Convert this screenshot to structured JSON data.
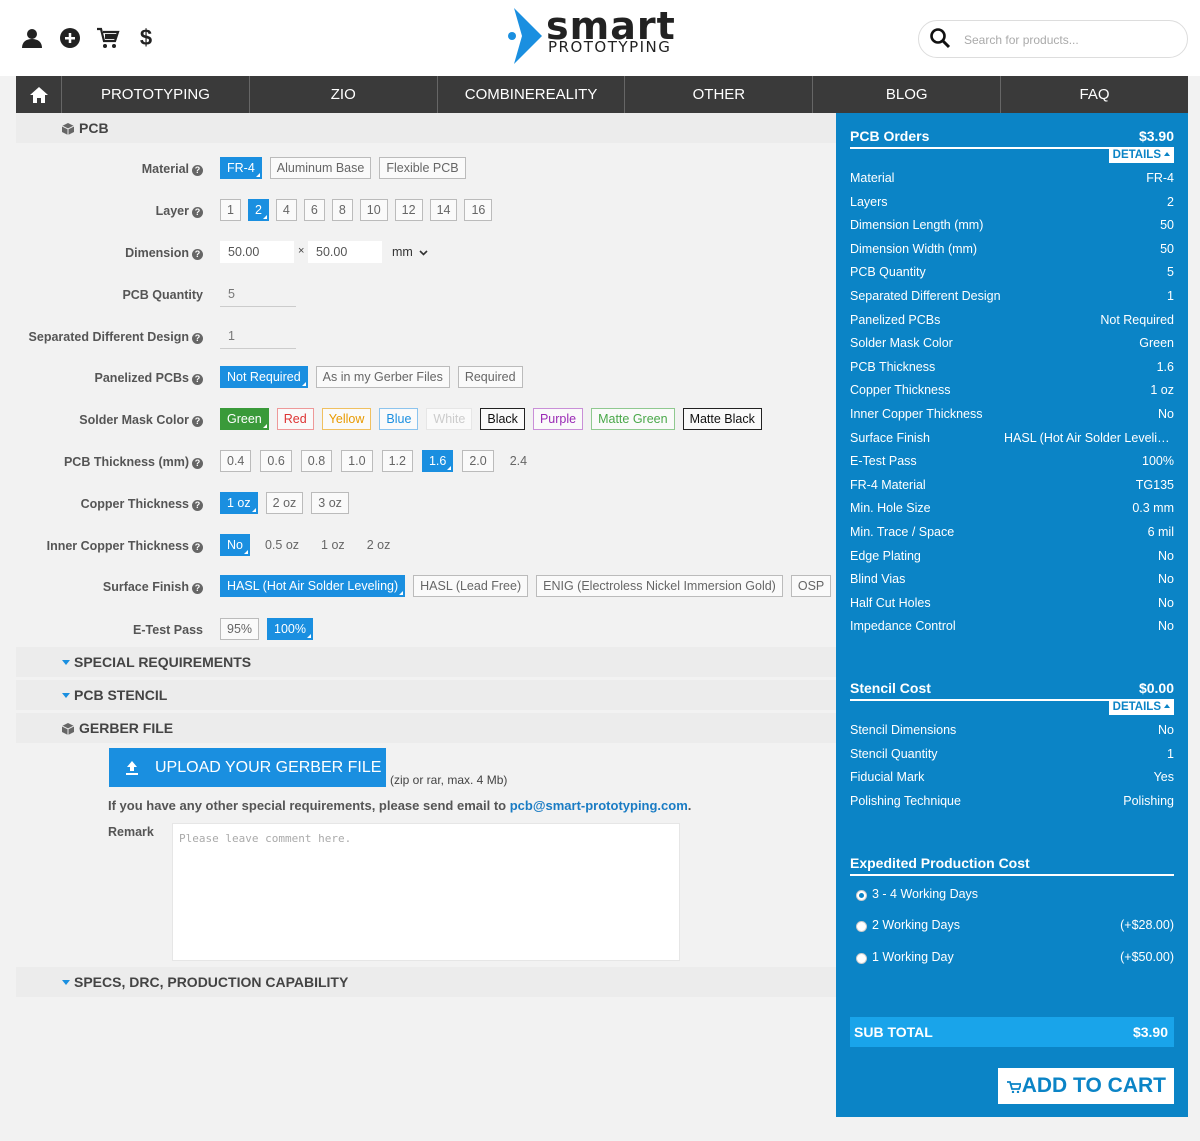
{
  "header": {
    "logo_word": "smart",
    "logo_sub": "PROTOTYPING",
    "search_placeholder": "Search for products..."
  },
  "nav": {
    "items": [
      "PROTOTYPING",
      "ZIO",
      "COMBINEREALITY",
      "OTHER",
      "BLOG",
      "FAQ"
    ]
  },
  "sections": {
    "pcb": "PCB",
    "special": "SPECIAL REQUIREMENTS",
    "stencil": "PCB STENCIL",
    "gerber": "GERBER FILE",
    "specs": "SPECS, DRC, PRODUCTION CAPABILITY"
  },
  "form": {
    "material": {
      "label": "Material",
      "options": [
        "FR-4",
        "Aluminum Base",
        "Flexible PCB"
      ],
      "selected": "FR-4"
    },
    "layer": {
      "label": "Layer",
      "options": [
        "1",
        "2",
        "4",
        "6",
        "8",
        "10",
        "12",
        "14",
        "16"
      ],
      "selected": "2"
    },
    "dimension": {
      "label": "Dimension",
      "length": "50.00",
      "width": "50.00",
      "times": "×",
      "unit": "mm"
    },
    "quantity": {
      "label": "PCB Quantity",
      "value": "5"
    },
    "separated": {
      "label": "Separated Different Design",
      "value": "1"
    },
    "panelized": {
      "label": "Panelized PCBs",
      "options": [
        "Not Required",
        "As in my Gerber Files",
        "Required"
      ],
      "selected": "Not Required"
    },
    "solder_mask": {
      "label": "Solder Mask Color",
      "options": [
        "Green",
        "Red",
        "Yellow",
        "Blue",
        "White",
        "Black",
        "Purple",
        "Matte Green",
        "Matte Black"
      ],
      "selected": "Green"
    },
    "thickness": {
      "label": "PCB Thickness (mm)",
      "options": [
        "0.4",
        "0.6",
        "0.8",
        "1.0",
        "1.2",
        "1.6",
        "2.0",
        "2.4"
      ],
      "selected": "1.6"
    },
    "copper": {
      "label": "Copper Thickness",
      "options": [
        "1 oz",
        "2 oz",
        "3 oz"
      ],
      "selected": "1 oz"
    },
    "inner_copper": {
      "label": "Inner Copper Thickness",
      "options": [
        "No",
        "0.5 oz",
        "1 oz",
        "2 oz"
      ],
      "selected": "No"
    },
    "surface": {
      "label": "Surface Finish",
      "options": [
        "HASL (Hot Air Solder Leveling)",
        "HASL (Lead Free)",
        "ENIG (Electroless Nickel Immersion Gold)",
        "OSP"
      ],
      "selected": "HASL (Hot Air Solder Leveling)"
    },
    "etest": {
      "label": "E-Test Pass",
      "options": [
        "95%",
        "100%"
      ],
      "selected": "100%"
    }
  },
  "gerber": {
    "upload_label": "UPLOAD YOUR GERBER FILE",
    "zip_note": "(zip or rar, max. 4 Mb)",
    "request_text": "If you have any other special requirements, please send email to ",
    "email": "pcb@smart-prototyping.com",
    "period": ".",
    "remark_label": "Remark",
    "remark_placeholder": "Please leave comment here."
  },
  "sidebar": {
    "pcb_orders": {
      "title": "PCB Orders",
      "price": "$3.90",
      "details": "DETAILS"
    },
    "pcb_rows": [
      {
        "k": "Material",
        "v": "FR-4"
      },
      {
        "k": "Layers",
        "v": "2"
      },
      {
        "k": "Dimension Length (mm)",
        "v": "50"
      },
      {
        "k": "Dimension Width (mm)",
        "v": "50"
      },
      {
        "k": "PCB Quantity",
        "v": "5"
      },
      {
        "k": "Separated Different Design",
        "v": "1"
      },
      {
        "k": "Panelized PCBs",
        "v": "Not Required"
      },
      {
        "k": "Solder Mask Color",
        "v": "Green"
      },
      {
        "k": "PCB Thickness",
        "v": "1.6"
      },
      {
        "k": "Copper Thickness",
        "v": "1 oz"
      },
      {
        "k": "Inner Copper Thickness",
        "v": "No"
      },
      {
        "k": "Surface Finish",
        "v": "HASL (Hot Air Solder Leveling)"
      },
      {
        "k": "E-Test Pass",
        "v": "100%"
      },
      {
        "k": "FR-4 Material",
        "v": "TG135"
      },
      {
        "k": "Min. Hole Size",
        "v": "0.3 mm"
      },
      {
        "k": "Min. Trace / Space",
        "v": "6 mil"
      },
      {
        "k": "Edge Plating",
        "v": "No"
      },
      {
        "k": "Blind Vias",
        "v": "No"
      },
      {
        "k": "Half Cut Holes",
        "v": "No"
      },
      {
        "k": "Impedance Control",
        "v": "No"
      }
    ],
    "stencil": {
      "title": "Stencil Cost",
      "price": "$0.00",
      "details": "DETAILS"
    },
    "stencil_rows": [
      {
        "k": "Stencil Dimensions",
        "v": "No"
      },
      {
        "k": "Stencil Quantity",
        "v": "1"
      },
      {
        "k": "Fiducial Mark",
        "v": "Yes"
      },
      {
        "k": "Polishing Technique",
        "v": "Polishing"
      }
    ],
    "expedited": {
      "title": "Expedited Production Cost",
      "options": [
        {
          "t": "3 - 4 Working Days",
          "p": "",
          "checked": true
        },
        {
          "t": "2 Working Days",
          "p": "(+$28.00)",
          "checked": false
        },
        {
          "t": "1 Working Day",
          "p": "(+$50.00)",
          "checked": false
        }
      ]
    },
    "subtotal": {
      "label": "SUB TOTAL",
      "value": "$3.90"
    },
    "add_to_cart": "ADD TO CART"
  },
  "colors": {
    "accent": "#1a8fe0",
    "sidebar": "#0b84c6",
    "nav": "#3a3a3a"
  }
}
